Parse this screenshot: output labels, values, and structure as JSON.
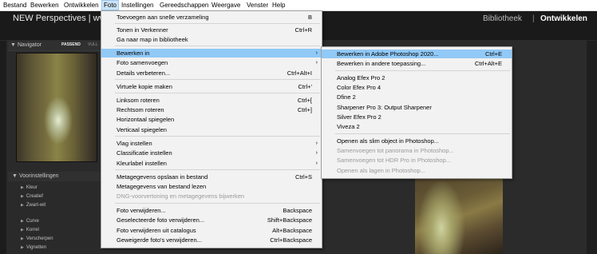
{
  "menubar": {
    "items": [
      "Bestand",
      "Bewerken",
      "Ontwikkelen",
      "Foto",
      "Instellingen",
      "Gereedschappen",
      "Weergave",
      "Venster",
      "Help"
    ]
  },
  "app": {
    "title": "NEW Perspectives | ww",
    "modules": {
      "library": "Bibliotheek",
      "separator": "|",
      "develop": "Ontwikkelen"
    }
  },
  "navigator": {
    "title": "Navigator",
    "fit": "PASSEND",
    "fill": "VULL"
  },
  "presets": {
    "title": "Voorinstellingen",
    "items": [
      "Kleur",
      "Creatief",
      "Zwart-wit",
      "Curve",
      "Korrel",
      "Verscherpen",
      "Vignetten"
    ]
  },
  "foto_menu": {
    "items": [
      {
        "label": "Toevoegen aan snelle verzameling",
        "shortcut": "B"
      },
      {
        "label": "Tonen in Verkenner",
        "shortcut": "Ctrl+R"
      },
      {
        "label": "Ga naar map in bibliotheek",
        "shortcut": ""
      },
      {
        "label": "Bewerken in",
        "shortcut": "",
        "submenu": true
      },
      {
        "label": "Foto samenvoegen",
        "shortcut": "",
        "submenu": true
      },
      {
        "label": "Details verbeteren...",
        "shortcut": "Ctrl+Alt+I"
      },
      {
        "label": "Virtuele kopie maken",
        "shortcut": "Ctrl+'"
      },
      {
        "label": "Linksom roteren",
        "shortcut": "Ctrl+["
      },
      {
        "label": "Rechtsom roteren",
        "shortcut": "Ctrl+]"
      },
      {
        "label": "Horizontaal spiegelen",
        "shortcut": ""
      },
      {
        "label": "Verticaal spiegelen",
        "shortcut": ""
      },
      {
        "label": "Vlag instellen",
        "shortcut": "",
        "submenu": true
      },
      {
        "label": "Classificatie instellen",
        "shortcut": "",
        "submenu": true
      },
      {
        "label": "Kleurlabel instellen",
        "shortcut": "",
        "submenu": true
      },
      {
        "label": "Metagegevens opslaan in bestand",
        "shortcut": "Ctrl+S"
      },
      {
        "label": "Metagegevens van bestand lezen",
        "shortcut": ""
      },
      {
        "label": "DNG-voorvertoning en metagegevens bijwerken",
        "shortcut": ""
      },
      {
        "label": "Foto verwijderen...",
        "shortcut": "Backspace"
      },
      {
        "label": "Geselecteerde foto verwijderen...",
        "shortcut": "Shift+Backspace"
      },
      {
        "label": "Foto verwijderen uit catalogus",
        "shortcut": "Alt+Backspace"
      },
      {
        "label": "Geweigerde foto's verwijderen...",
        "shortcut": "Ctrl+Backspace"
      }
    ]
  },
  "bewerken_submenu": {
    "items": [
      {
        "label": "Bewerken in Adobe Photoshop 2020...",
        "shortcut": "Ctrl+E"
      },
      {
        "label": "Bewerken in andere toepassing...",
        "shortcut": "Ctrl+Alt+E"
      },
      {
        "label": "Analog Efex Pro 2",
        "shortcut": ""
      },
      {
        "label": "Color Efex Pro 4",
        "shortcut": ""
      },
      {
        "label": "Dfine 2",
        "shortcut": ""
      },
      {
        "label": "Sharpener Pro 3: Output Sharpener",
        "shortcut": ""
      },
      {
        "label": "Silver Efex Pro 2",
        "shortcut": ""
      },
      {
        "label": "Viveza 2",
        "shortcut": ""
      },
      {
        "label": "Openen als slim object in Photoshop...",
        "shortcut": ""
      },
      {
        "label": "Samenvoegen tot panorama in Photoshop...",
        "shortcut": ""
      },
      {
        "label": "Samenvoegen tot HDR Pro in Photoshop...",
        "shortcut": ""
      },
      {
        "label": "Openen als lagen in Photoshop...",
        "shortcut": ""
      }
    ]
  },
  "colors": {
    "menu_highlight": "#91c9f7",
    "active_menubar": "#cce4f7",
    "disabled_text": "#9a9a9a"
  }
}
